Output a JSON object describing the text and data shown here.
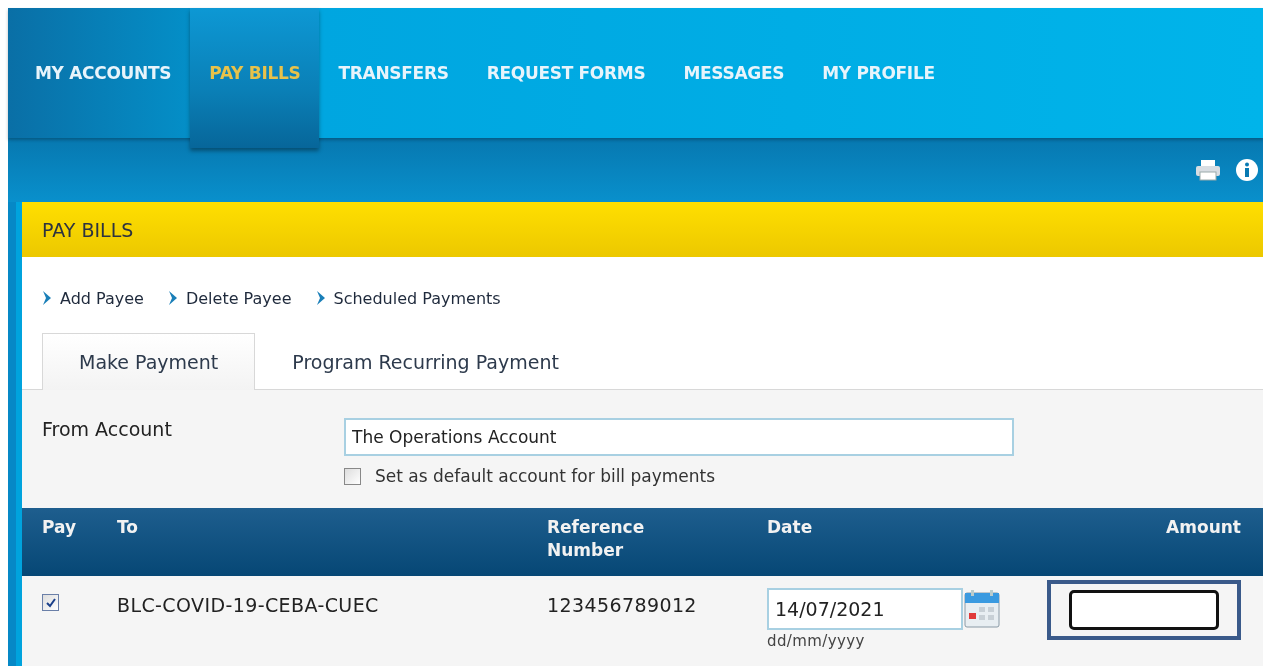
{
  "nav": [
    {
      "label": "MY ACCOUNTS",
      "selected": false
    },
    {
      "label": "PAY BILLS",
      "selected": true
    },
    {
      "label": "TRANSFERS",
      "selected": false
    },
    {
      "label": "REQUEST FORMS",
      "selected": false
    },
    {
      "label": "MESSAGES",
      "selected": false
    },
    {
      "label": "MY PROFILE",
      "selected": false
    }
  ],
  "panel": {
    "title": "PAY BILLS",
    "links": [
      "Add Payee",
      "Delete Payee",
      "Scheduled Payments"
    ],
    "tabs": [
      {
        "label": "Make Payment",
        "selected": true
      },
      {
        "label": "Program Recurring Payment",
        "selected": false
      }
    ],
    "from_account": {
      "label": "From Account",
      "value": "The Operations Account"
    },
    "default_checkbox": {
      "label": "Set as default account for bill payments",
      "checked": false
    },
    "table": {
      "columns": [
        "Pay",
        "To",
        "Reference\nNumber",
        "Date",
        "Amount"
      ],
      "rows": [
        {
          "pay": true,
          "to": "BLC-COVID-19-CEBA-CUEC",
          "reference": "123456789012",
          "date": "14/07/2021",
          "date_hint": "dd/mm/yyyy",
          "amount_focused": true
        }
      ]
    }
  }
}
